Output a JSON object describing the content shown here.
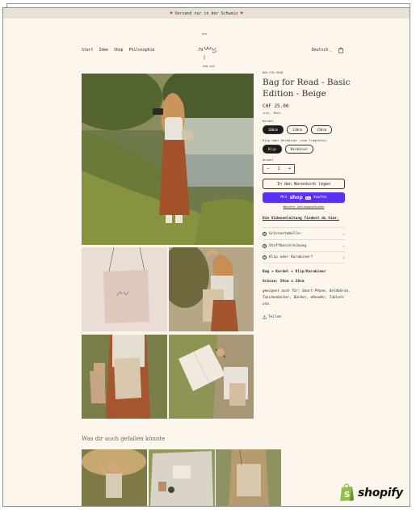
{
  "announcement": {
    "heart": "♥",
    "text": "Versand nur in der Schweiz"
  },
  "header": {
    "nav": [
      "Start",
      "Idee",
      "Shop",
      "Philosophie"
    ],
    "logo_top": "mna",
    "logo_text": "Bag for Read",
    "logo_sub": "bag yoO",
    "language": "Deutsch",
    "cart_icon": "shopping-bag-icon"
  },
  "product": {
    "vendor": "BAG FOR READ",
    "title": "Bag for Read - Basic Edition - Beige",
    "price": "CHF 25.00",
    "tax_note": "inkl. MwSt.",
    "kordel_label": "Kordel",
    "kordel_options": [
      "100cm",
      "120cm",
      "150cm"
    ],
    "kordel_selected": "100cm",
    "clip_label": "Klip oder Karabiner (zum Tragenfik)",
    "clip_options": [
      "Klip",
      "Karabiner"
    ],
    "clip_selected": "Klip",
    "qty_label": "Anzahl",
    "qty_minus": "−",
    "qty_value": "1",
    "qty_plus": "+",
    "add_to_cart": "In den Warenkorb legen",
    "shop_pay_prefix": "Mit",
    "shop_pay_logo": "shop",
    "shop_pay_badge": "Pay",
    "shop_pay_suffix": "kaufen",
    "more_payment": "Weitere Zahlungsoptionen",
    "video_link": "Die Videoanleitung findest du hier.",
    "accordion": [
      {
        "icon": "?",
        "label": "Grössentabelle:"
      },
      {
        "icon": "?",
        "label": "Stoffbeschreibung"
      },
      {
        "icon": "?",
        "label": "Klip oder Karabiner?"
      }
    ],
    "desc_strong": "Bag + Kordel + Klip/Karabiner",
    "desc_size": "Grösse: 29cm x 28cm",
    "desc_italic": "geeignet auch für: Smart-Phone, Geldbörse, Taschenbücher, Bücher, eReader, Tablets usw.",
    "share": "Teilen"
  },
  "recommend_title": "Was dir auch gefallen könnte",
  "shopify_brand": "shopify",
  "colors": {
    "background": "#fdf6ec",
    "announcement": "#e8e1d6",
    "shop_pay": "#5a31f4",
    "shopify_green": "#95bf47"
  }
}
